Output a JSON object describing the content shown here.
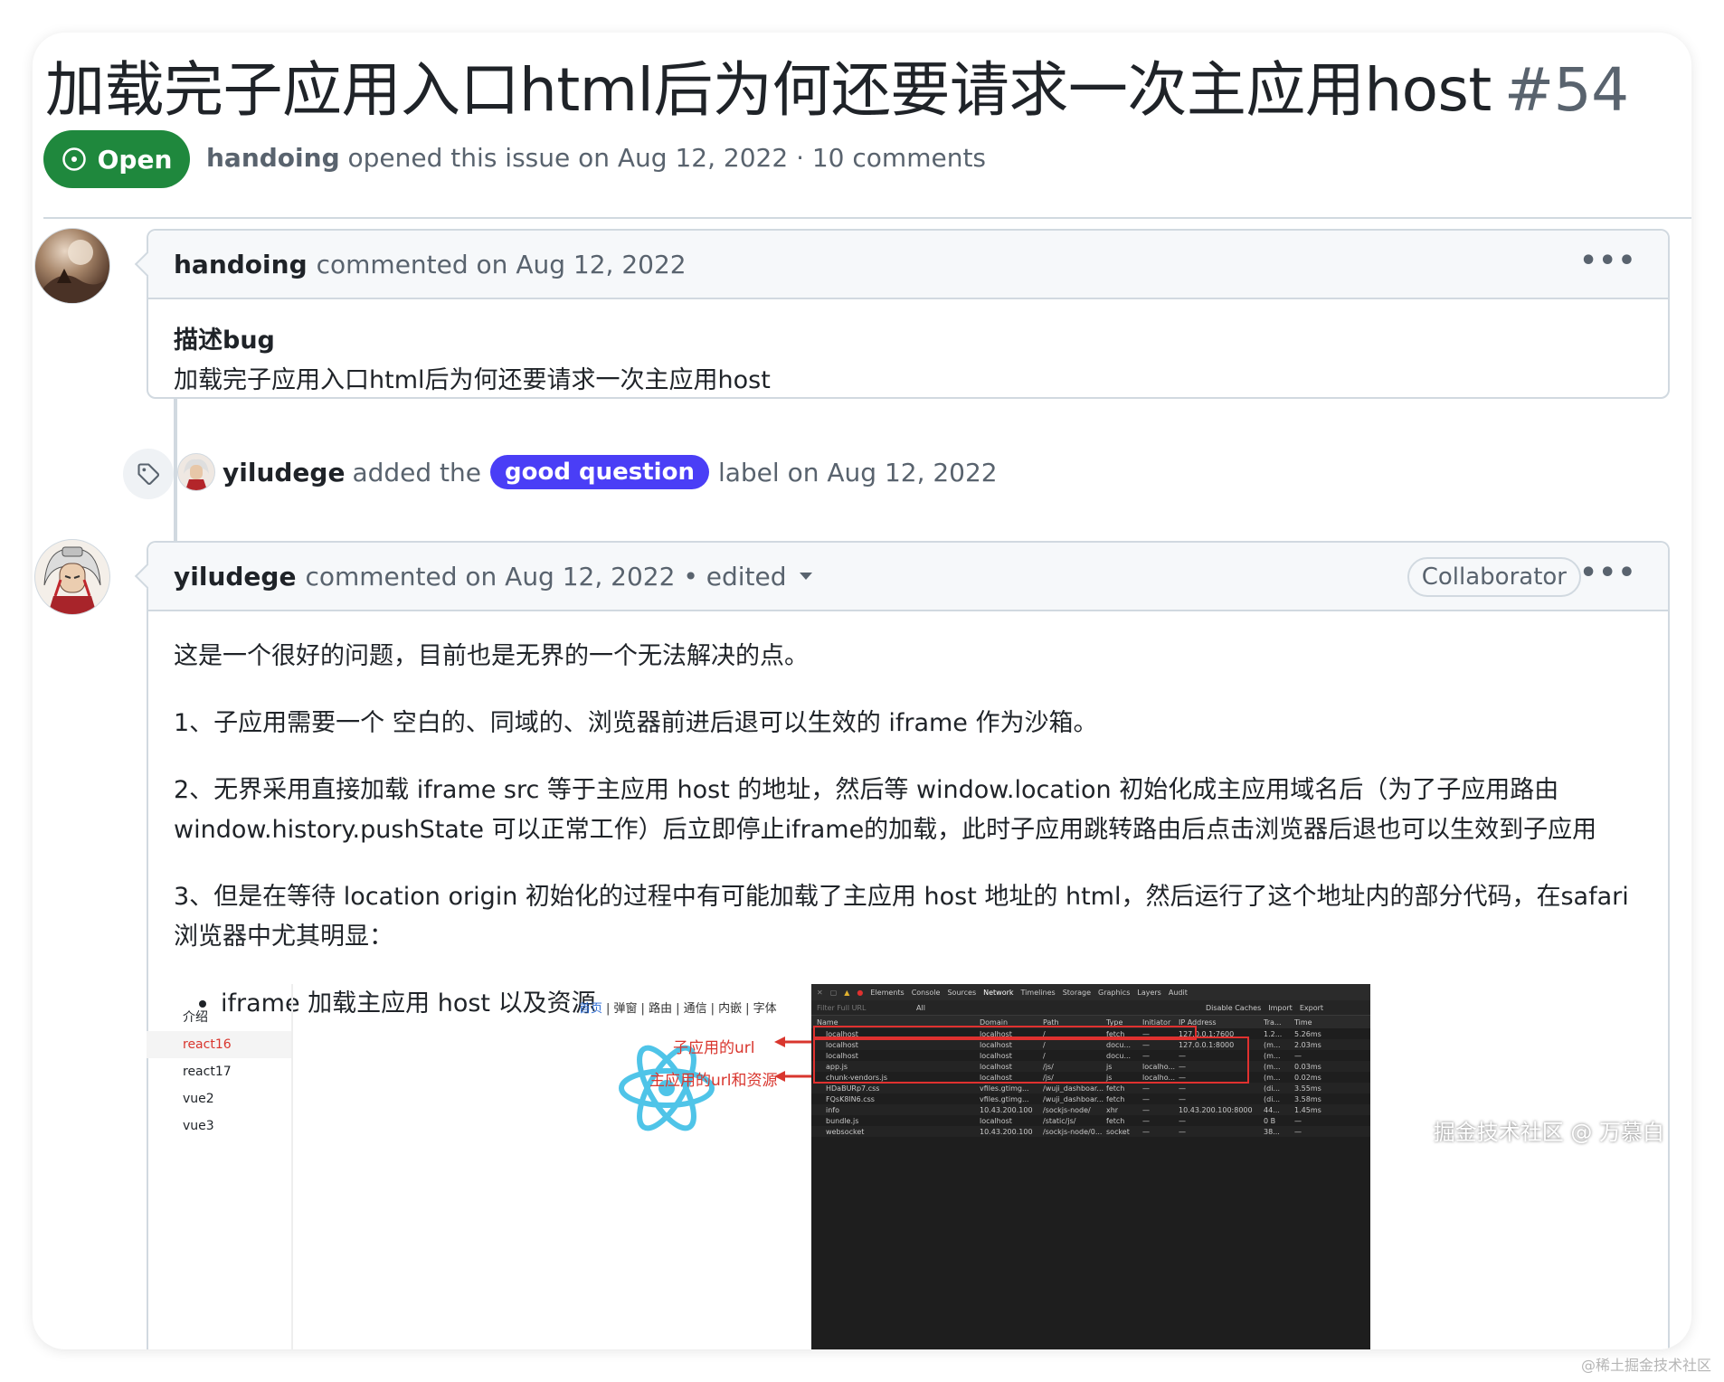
{
  "issue": {
    "title": "加载完子应用入口html后为何还要请求一次主应用host",
    "number": "#54",
    "state": "Open",
    "author": "handoing",
    "meta_rest": "opened this issue on Aug 12, 2022 · 10 comments"
  },
  "comment1": {
    "author": "handoing",
    "meta": "commented on Aug 12, 2022",
    "ellipsis": "•••",
    "heading": "描述bug",
    "text": "加载完子应用入口html后为何还要请求一次主应用host"
  },
  "event": {
    "actor": "yiludege",
    "before": "added the",
    "label": "good question",
    "after": "label on Aug 12, 2022",
    "label_color": "#4a3ef6"
  },
  "comment2": {
    "author": "yiludege",
    "meta": "commented on Aug 12, 2022 • edited",
    "role": "Collaborator",
    "ellipsis": "•••",
    "p1": "这是一个很好的问题，目前也是无界的一个无法解决的点。",
    "p2": "1、子应用需要一个 空白的、同域的、浏览器前进后退可以生效的 iframe 作为沙箱。",
    "p3": "2、无界采用直接加载 iframe src 等于主应用 host 的地址，然后等 window.location 初始化成主应用域名后（为了子应用路由window.history.pushState 可以正常工作）后立即停止iframe的加载，此时子应用跳转路由后点击浏览器后退也可以生效到子应用",
    "p4": "3、但是在等待 location origin 初始化的过程中有可能加载了主应用 host 地址的 html，然后运行了这个地址内的部分代码，在safari 浏览器中尤其明显：",
    "bullet1": "iframe 加载主应用 host 以及资源"
  },
  "embed": {
    "side_nav": [
      "介绍",
      "react16",
      "react17",
      "vue2",
      "vue3"
    ],
    "nav_links": [
      "首页",
      "弹窗",
      "路由",
      "通信",
      "内嵌",
      "字体"
    ],
    "label_sub_url": "子应用的url",
    "label_main_url": "主应用的url和资源",
    "devtools_tabs": [
      "Elements",
      "Console",
      "Sources",
      "Network",
      "Timelines",
      "Storage",
      "Graphics",
      "Layers",
      "Audit"
    ],
    "filter_placeholder": "Filter Full URL",
    "filter_all": "All",
    "filter_actions": [
      "Disable Caches",
      "Import",
      "Export"
    ],
    "columns": [
      "Name",
      "Domain",
      "Path",
      "Type",
      "Initiator",
      "IP Address",
      "Tra...",
      "Time"
    ],
    "rows": [
      [
        "localhost",
        "localhost",
        "/",
        "fetch",
        "—",
        "127.0.0.1:7600",
        "1.2...",
        "5.26ms"
      ],
      [
        "localhost",
        "localhost",
        "/",
        "docu...",
        "—",
        "127.0.0.1:8000",
        "(m...",
        "2.03ms"
      ],
      [
        "localhost",
        "localhost",
        "/",
        "docu...",
        "—",
        "—",
        "(m...",
        "—"
      ],
      [
        "app.js",
        "localhost",
        "/js/",
        "js",
        "localho...",
        "—",
        "(m...",
        "0.03ms"
      ],
      [
        "chunk-vendors.js",
        "localhost",
        "/js/",
        "js",
        "localho...",
        "—",
        "(m...",
        "0.02ms"
      ],
      [
        "HDaBURp7.css",
        "vfiles.gtimg...",
        "/wuji_dashboar...",
        "fetch",
        "—",
        "—",
        "(di...",
        "3.55ms"
      ],
      [
        "FQsK8lN6.css",
        "vfiles.gtimg...",
        "/wuji_dashboar...",
        "fetch",
        "—",
        "—",
        "(di...",
        "3.58ms"
      ],
      [
        "info",
        "10.43.200.100",
        "/sockjs-node/",
        "xhr",
        "—",
        "10.43.200.100:8000",
        "44...",
        "1.45ms"
      ],
      [
        "bundle.js",
        "localhost",
        "/static/js/",
        "fetch",
        "—",
        "—",
        "0 B",
        "—"
      ],
      [
        "websocket",
        "10.43.200.100",
        "/sockjs-node/0...",
        "socket",
        "—",
        "—",
        "38...",
        "—"
      ]
    ]
  },
  "watermark": "掘金技术社区 @ 万慕白",
  "watermark2": "@稀土掘金技术社区"
}
